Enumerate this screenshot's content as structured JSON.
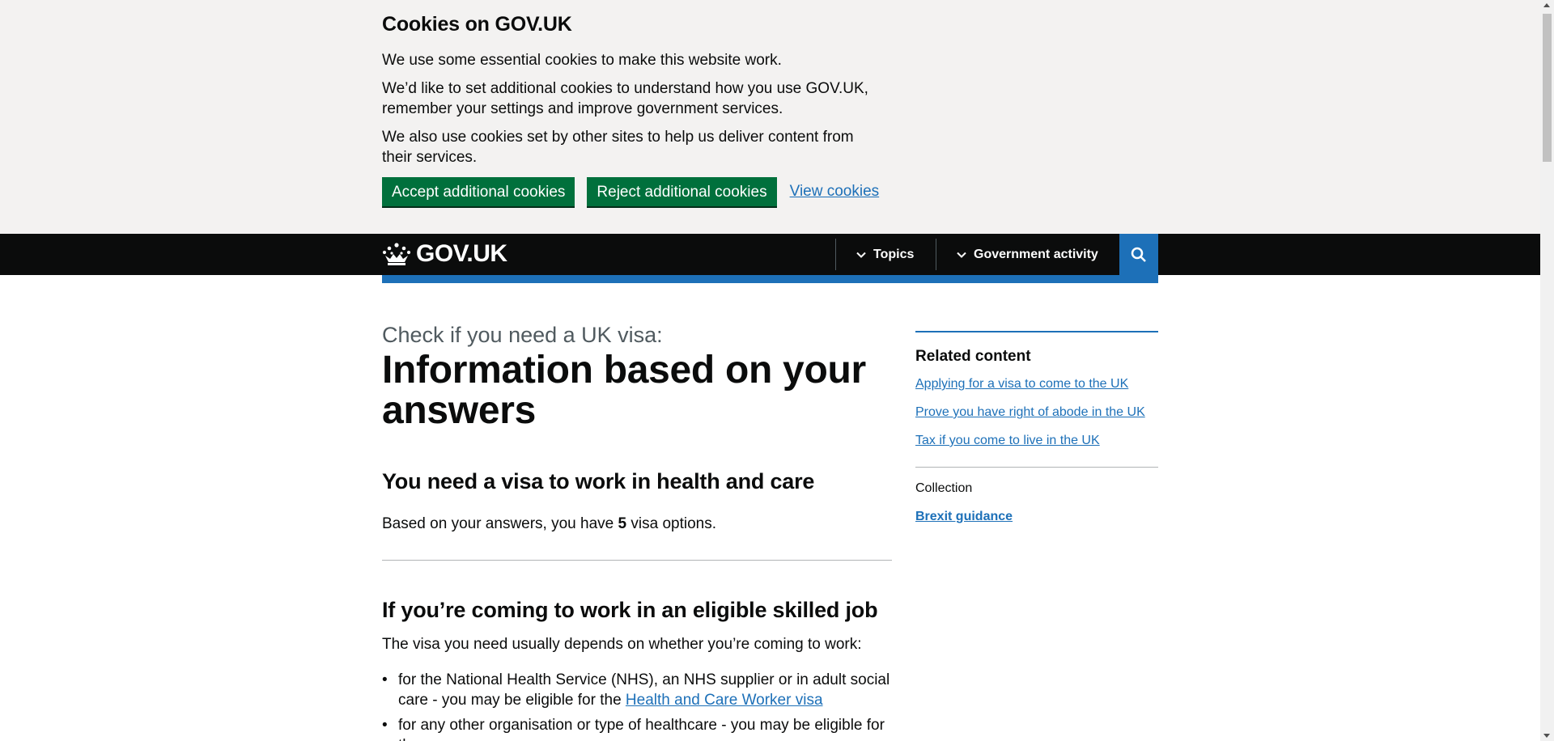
{
  "cookie_banner": {
    "title": "Cookies on GOV.UK",
    "p1": "We use some essential cookies to make this website work.",
    "p2": "We’d like to set additional cookies to understand how you use GOV.UK, remember your settings and improve government services.",
    "p3": "We also use cookies set by other sites to help us deliver content from their services.",
    "accept_label": "Accept additional cookies",
    "reject_label": "Reject additional cookies",
    "view_label": "View cookies"
  },
  "header": {
    "logo_text": "GOV.UK",
    "nav": [
      {
        "label": "Topics",
        "icon": "chevron-down-icon"
      },
      {
        "label": "Government activity",
        "icon": "chevron-down-icon"
      }
    ],
    "search_icon": "search-icon"
  },
  "main": {
    "caption": "Check if you need a UK visa:",
    "title": "Information based on your answers",
    "section1": {
      "heading": "You need a visa to work in health and care",
      "text_before": "Based on your answers, you have ",
      "count": "5",
      "text_after": " visa options."
    },
    "section2": {
      "heading": "If you’re coming to work in an eligible skilled job",
      "intro": "The visa you need usually depends on whether you’re coming to work:",
      "bullets": [
        {
          "text": "for the National Health Service (NHS), an NHS supplier or in adult social care - you may be eligible for the ",
          "link": "Health and Care Worker visa"
        },
        {
          "text": "for any other organisation or type of healthcare - you may be eligible for the",
          "link": ""
        }
      ]
    }
  },
  "sidebar": {
    "title": "Related content",
    "links": [
      "Applying for a visa to come to the UK",
      "Prove you have right of abode in the UK",
      "Tax if you come to live in the UK"
    ],
    "collection_label": "Collection",
    "collection_link": "Brexit guidance"
  },
  "colors": {
    "link": "#1d70b8",
    "button_green": "#00703c",
    "header_black": "#0b0c0c",
    "banner_bg": "#f3f2f1"
  }
}
